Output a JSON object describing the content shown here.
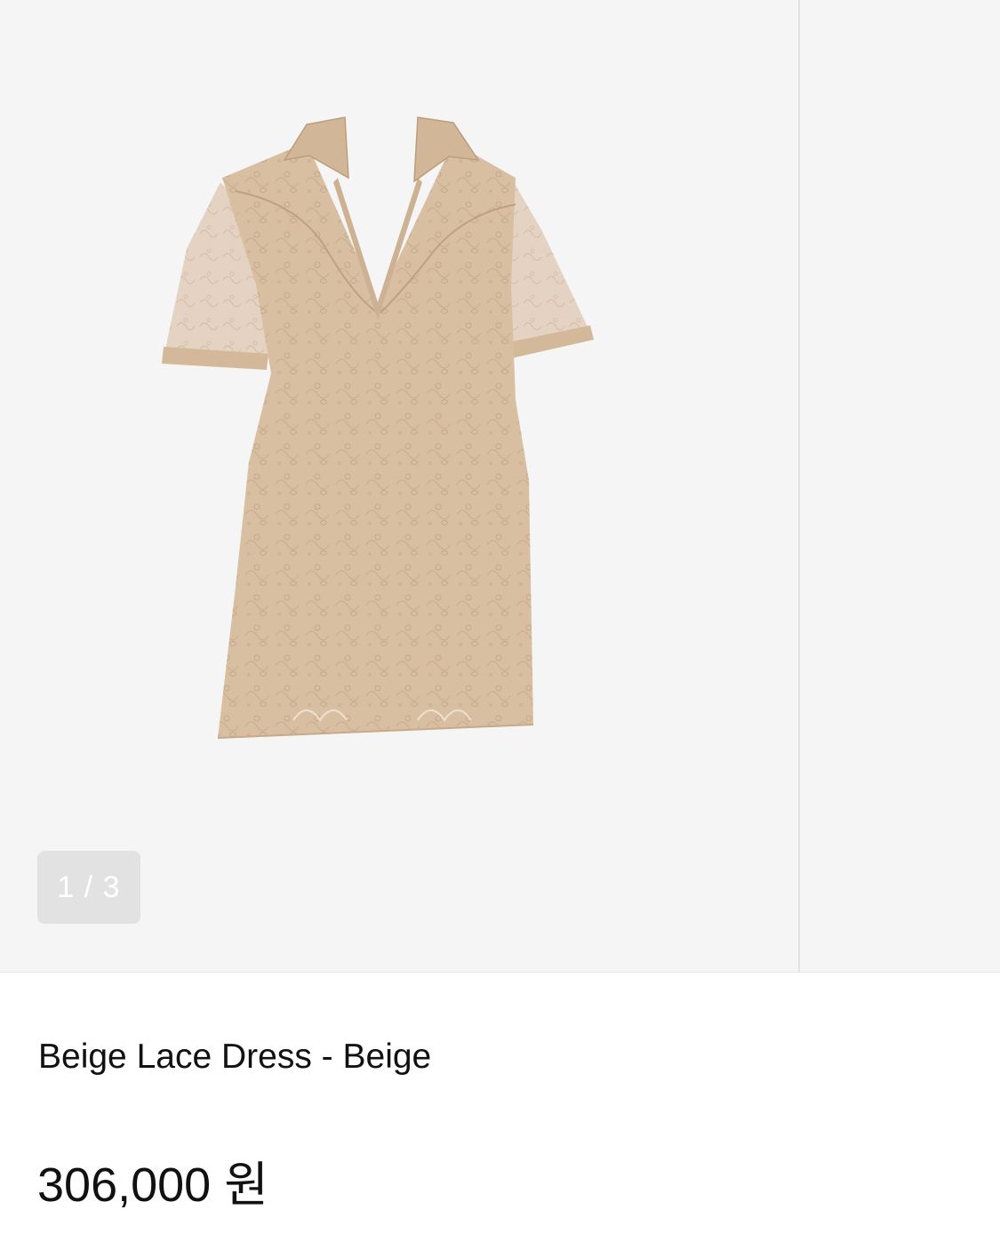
{
  "gallery": {
    "counter": "1 / 3",
    "image_subject": "dress-image"
  },
  "product": {
    "title": "Beige Lace Dress - Beige",
    "price_amount": "306,000",
    "price_unit": "원"
  },
  "colors": {
    "gallery_bg": "#f5f5f5",
    "dress_fill": "#d9bfa2",
    "counter_bg": "#e2e2e2",
    "text": "#111111"
  }
}
